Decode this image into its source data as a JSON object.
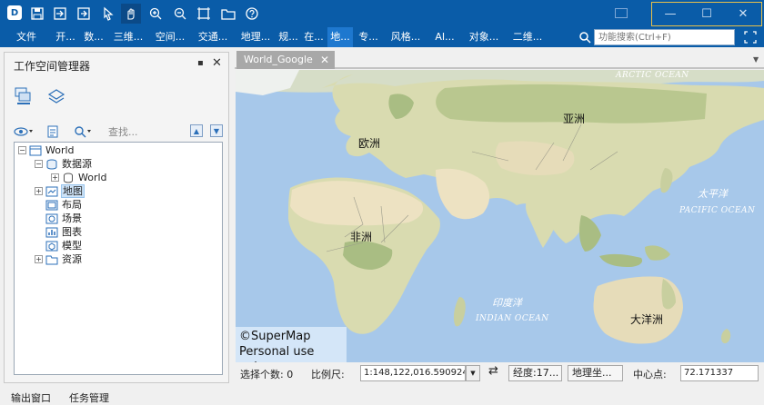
{
  "titlebar": {
    "app_icon": "supermap-logo-icon",
    "app_icon_text": "D",
    "tools": [
      "save-icon",
      "import-icon",
      "export-icon",
      "select-arrow-icon",
      "pan-hand-icon",
      "zoom-in-icon",
      "zoom-out-icon",
      "full-extent-icon",
      "open-folder-icon",
      "help-icon"
    ],
    "window_controls": {
      "minimize": "—",
      "maximize": "☐",
      "close": "✕"
    }
  },
  "menubar": {
    "items": [
      "文件",
      "开...",
      "数...",
      "三维...",
      "空间...",
      "交通...",
      "地理...",
      "规...",
      "在...",
      "地...",
      "专...",
      "风格...",
      "AI...",
      "对象...",
      "二维..."
    ],
    "selected_index": 9,
    "search_placeholder": "功能搜索(Ctrl+F)"
  },
  "workspace_panel": {
    "title": "工作空间管理器",
    "pin": "▪",
    "close": "✕",
    "search_placeholder": "查找...",
    "tree": {
      "root": "World",
      "datasource": "数据源",
      "datasource_child": "World",
      "map": "地图",
      "layout": "布局",
      "scene": "场景",
      "chart": "图表",
      "model": "模型",
      "resources": "资源"
    }
  },
  "document": {
    "tab_title": "World_Google",
    "tab_close": "✕"
  },
  "map": {
    "labels": {
      "arctic": "ARCTIC OCEAN",
      "asia": "亚洲",
      "europe": "欧洲",
      "africa": "非洲",
      "oceania": "大洋洲",
      "pacific_cn": "太平洋",
      "pacific_en": "PACIFIC OCEAN",
      "indian_cn": "印度洋",
      "indian_en": "INDIAN OCEAN"
    },
    "copyright_line1": "©SuperMap",
    "copyright_line2": "Personal use only",
    "colors": {
      "ocean": "#a7c8ea",
      "land": "#d9dbb0",
      "desert": "#ede2c2",
      "forest": "#a9bd83",
      "ice": "#f4f4f4"
    }
  },
  "statusbar": {
    "selection": "选择个数: 0",
    "scale_label": "比例尺:",
    "scale_value": "1:148,122,016.590924",
    "swap_icon": "⇄",
    "longitude": "经度:17...",
    "geo_coord": "地理坐...",
    "center_label": "中心点:",
    "center_value": "72.171337"
  },
  "bottom_tabs": [
    "输出窗口",
    "任务管理"
  ]
}
